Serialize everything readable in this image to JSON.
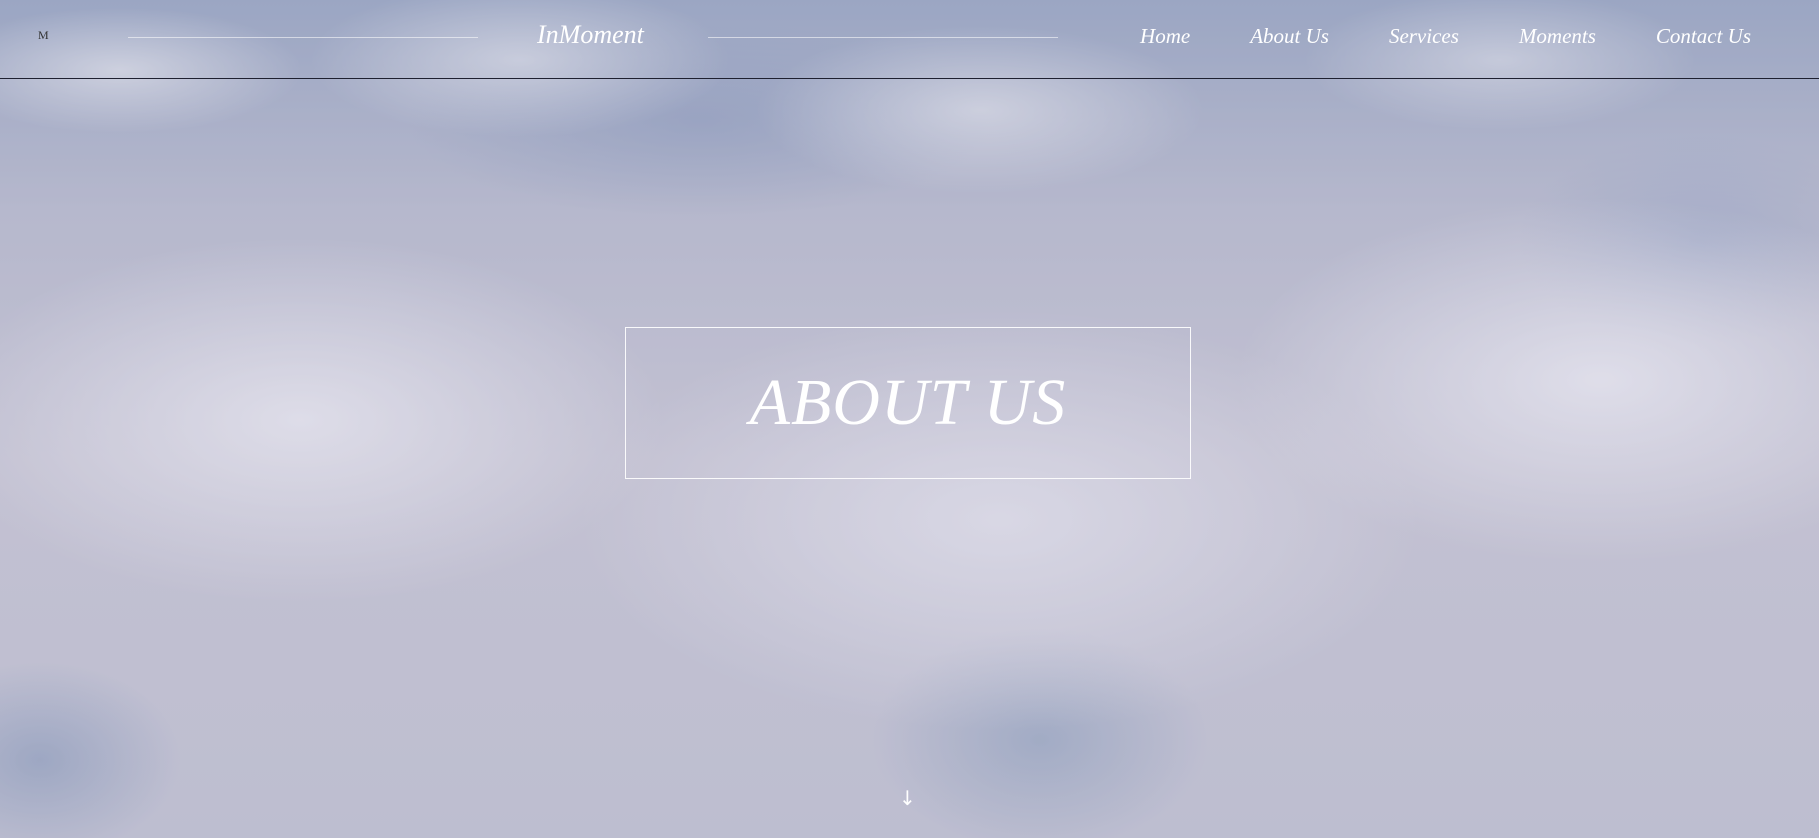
{
  "header": {
    "logo_mark": "M",
    "brand": "InMoment",
    "nav": [
      "Home",
      "About Us",
      "Services",
      "Moments",
      "Contact Us"
    ]
  },
  "hero": {
    "title": "ABOUT US",
    "scroll_arrow": "↓"
  },
  "colors": {
    "text": "#ffffff",
    "divider": "#1e2030",
    "overlay": "#bebcd0"
  },
  "icons": {
    "logo": "logo-icon",
    "scroll": "arrow-down-icon"
  }
}
